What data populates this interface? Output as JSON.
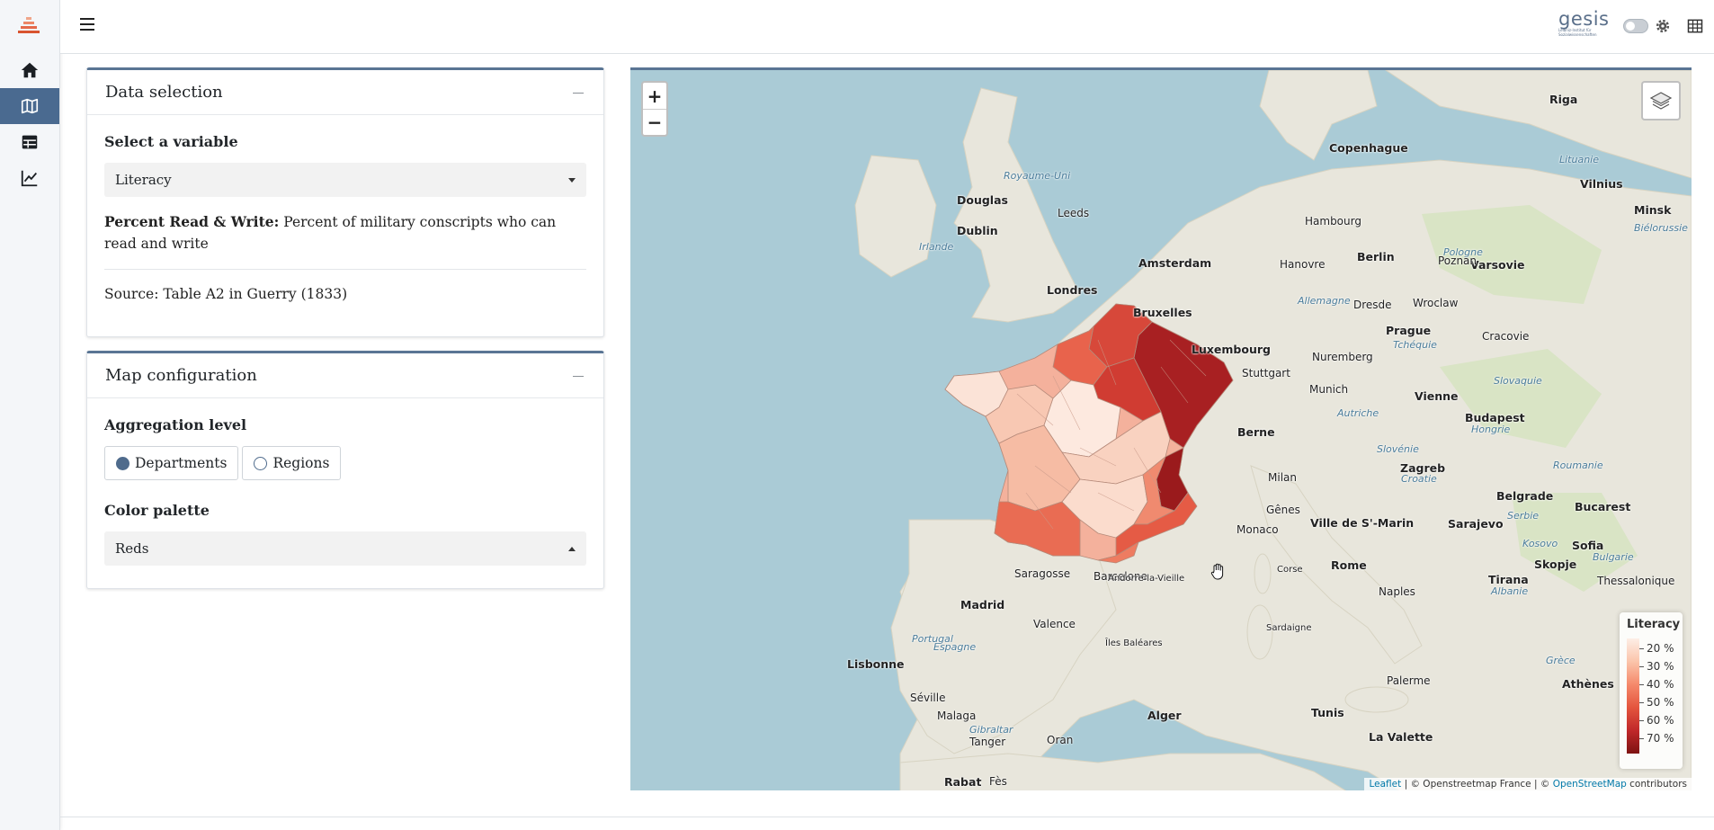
{
  "sidebar": {
    "items": [
      {
        "name": "home",
        "icon": "home-icon",
        "active": false
      },
      {
        "name": "map",
        "icon": "map-icon",
        "active": true
      },
      {
        "name": "table",
        "icon": "table-icon",
        "active": false
      },
      {
        "name": "chart",
        "icon": "chart-line-icon",
        "active": false
      }
    ]
  },
  "header": {
    "logo_text": "gesis",
    "logo_subtext": "Leibniz-Institut für Sozialwissenschaften"
  },
  "data_selection": {
    "title": "Data selection",
    "variable_label": "Select a variable",
    "variable_value": "Literacy",
    "desc_title": "Percent Read & Write:",
    "desc_text": " Percent of military conscripts who can read and write",
    "source": "Source: Table A2 in Guerry (1833)"
  },
  "map_config": {
    "title": "Map configuration",
    "aggregation_label": "Aggregation level",
    "options": [
      "Departments",
      "Regions"
    ],
    "selected_option": "Departments",
    "palette_label": "Color palette",
    "palette_value": "Reds"
  },
  "map": {
    "zoom_in": "+",
    "zoom_out": "−",
    "legend": {
      "title": "Literacy",
      "labels": [
        "20 %",
        "30 %",
        "40 %",
        "50 %",
        "60 %",
        "70 %"
      ]
    },
    "attribution": {
      "leaflet": "Leaflet",
      "osm_france": " | © Openstreetmap France | © ",
      "osm": "OpenStreetMap",
      "contributors": " contributors"
    },
    "place_labels": {
      "copenhagen": "Copenhague",
      "dublin": "Dublin",
      "douglas": "Douglas",
      "leeds": "Leeds",
      "amsterdam": "Amsterdam",
      "hamburg": "Hambourg",
      "berlin": "Berlin",
      "varsovie": "Varsovie",
      "londres": "Londres",
      "bruxelles": "Bruxelles",
      "luxembourg": "Luxembourg",
      "prague": "Prague",
      "stuttgart": "Stuttgart",
      "munich": "Munich",
      "vienne": "Vienne",
      "budapest": "Budapest",
      "berne": "Berne",
      "milan": "Milan",
      "zagreb": "Zagreb",
      "belgrade": "Belgrade",
      "bucarest": "Bucarest",
      "genes": "Gênes",
      "monaco": "Monaco",
      "ville_saint_marin": "Ville de S'-Marin",
      "sarajevo": "Sarajevo",
      "skopje": "Skopje",
      "sofia": "Sofia",
      "tirana": "Tirana",
      "rome": "Rome",
      "naples": "Naples",
      "madrid": "Madrid",
      "barcelone": "Barcelone",
      "saragosse": "Saragosse",
      "valence": "Valence",
      "lisbonne": "Lisbonne",
      "seville": "Séville",
      "malaga": "Malaga",
      "alger": "Alger",
      "tunis": "Tunis",
      "palerme": "Palerme",
      "la_valette": "La Valette",
      "athenes": "Athènes",
      "rabat": "Rabat",
      "fes": "Fès",
      "oran": "Oran",
      "riga": "Riga",
      "vilnius": "Vilnius",
      "minsk": "Minsk",
      "andorre": "Andorre-la-Vieille",
      "irlande": "Irlande",
      "royaume_uni": "Royaume-Uni",
      "espagne": "Espagne",
      "portugal": "Portugal",
      "allemagne": "Allemagne",
      "pologne": "Pologne",
      "autriche": "Autriche",
      "hongrie": "Hongrie",
      "roumanie": "Roumanie",
      "slovaquie": "Slovaquie",
      "serbie": "Serbie",
      "bulgarie": "Bulgarie",
      "grece": "Grèce",
      "croatie": "Croatie",
      "lituanie": "Lituanie",
      "bielorussie": "Biélorussie",
      "kosovo": "Kosovo",
      "albanie": "Albanie",
      "tchequie": "Tchéquie",
      "slovenie": "Slovénie",
      "iles_baleares": "Îles Baléares",
      "sardaigne": "Sardaigne",
      "corse": "Corse",
      "gibraltar": "Gibraltar",
      "tanger": "Tanger",
      "thessalonique": "Thessalonique",
      "poznan": "Poznan",
      "wroclaw": "Wroclaw",
      "cracovie": "Cracovie",
      "dresde": "Dresde",
      "hanovre": "Hanovre",
      "nuremberg": "Nuremberg"
    }
  },
  "colors": {
    "accent": "#4a6a90",
    "choropleth_low": "#fdeee6",
    "choropleth_high": "#7e1312"
  }
}
